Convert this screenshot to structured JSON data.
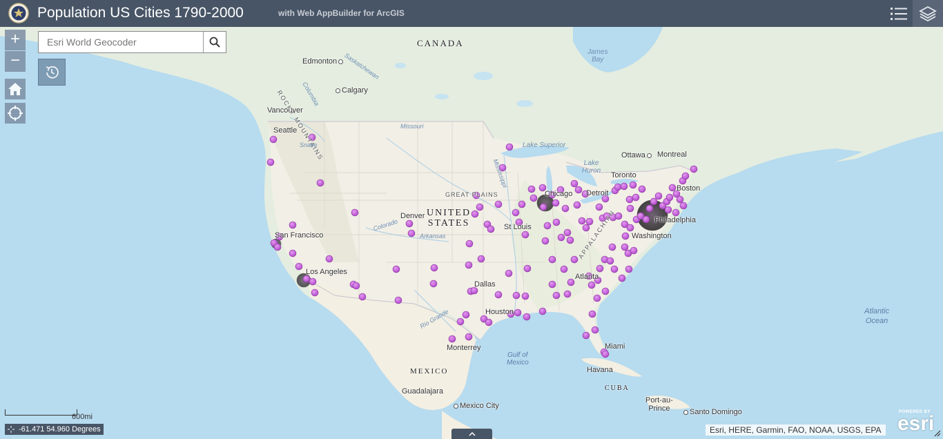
{
  "header": {
    "title": "Population US Cities 1790-2000",
    "subtitle": "with Web AppBuilder for ArcGIS"
  },
  "search": {
    "placeholder": "Esri World Geocoder"
  },
  "zoom": {
    "in_label": "+",
    "out_label": "−"
  },
  "scale": {
    "label": "600mi"
  },
  "coordinates": {
    "text": "-61.471 54.960 Degrees"
  },
  "attribution": "Esri, HERE, Garmin, FAO, NOAA, USGS, EPA",
  "esri_logo": {
    "powered": "POWERED BY",
    "word": "esri"
  },
  "colors": {
    "header": "#485566",
    "water": "#b7dbef",
    "land": "#f2efe6",
    "canada": "#e4ede0",
    "points": "#c261d8",
    "widget": "#7d8fa3"
  },
  "icons": {
    "logo": "seal-icon",
    "legend": "list-icon",
    "layers": "layers-icon",
    "search": "search-icon",
    "home": "home-icon",
    "locate": "locate-icon",
    "history": "history-icon",
    "coords": "crosshair-icon",
    "expand": "chevron-up-icon"
  },
  "map_labels": {
    "canada": "CANADA",
    "united_states": "UNITED\nSTATES",
    "mexico": "MEXICO",
    "cuba": "CUBA",
    "rocky_mountains": "ROCKY MOUNTAINS",
    "appalachian": "APPALACHIAN",
    "great_plains": "GREAT PLAINS",
    "atlantic_ocean": "Atlantic\nOcean",
    "gulf_of_mexico": "Gulf of\nMexico",
    "james_bay": "James\nBay",
    "lake_superior": "Lake Superior",
    "lake_huron": "Lake\nHuron",
    "missouri": "Missouri",
    "mississippi": "Mississippi",
    "colorado": "Colorado",
    "arkansas": "Arkansas",
    "rio_grande": "Rio Grande",
    "saskatchewan": "Saskatchewan",
    "columbia": "Columbia",
    "snake": "Snake",
    "cities": {
      "edmonton": "Edmonton",
      "calgary": "Calgary",
      "vancouver": "Vancouver",
      "seattle": "Seattle",
      "san_francisco": "San Francisco",
      "los_angeles": "Los Angeles",
      "denver": "Denver",
      "chicago": "Chicago",
      "detroit": "Detroit",
      "toronto": "Toronto",
      "ottawa": "Ottawa",
      "montreal": "Montreal",
      "boston": "Boston",
      "philadelphia": "Philadelphia",
      "washington": "Washington",
      "st_louis": "St Louis",
      "atlanta": "Atlanta",
      "dallas": "Dallas",
      "houston": "Houston",
      "miami": "Miami",
      "havana": "Havana",
      "monterrey": "Monterrey",
      "guadalajara": "Guadalajara",
      "mexico_city": "Mexico City",
      "port_au_prince": "Port-au-\nPrince",
      "santo_domingo": "Santo Domingo"
    }
  }
}
